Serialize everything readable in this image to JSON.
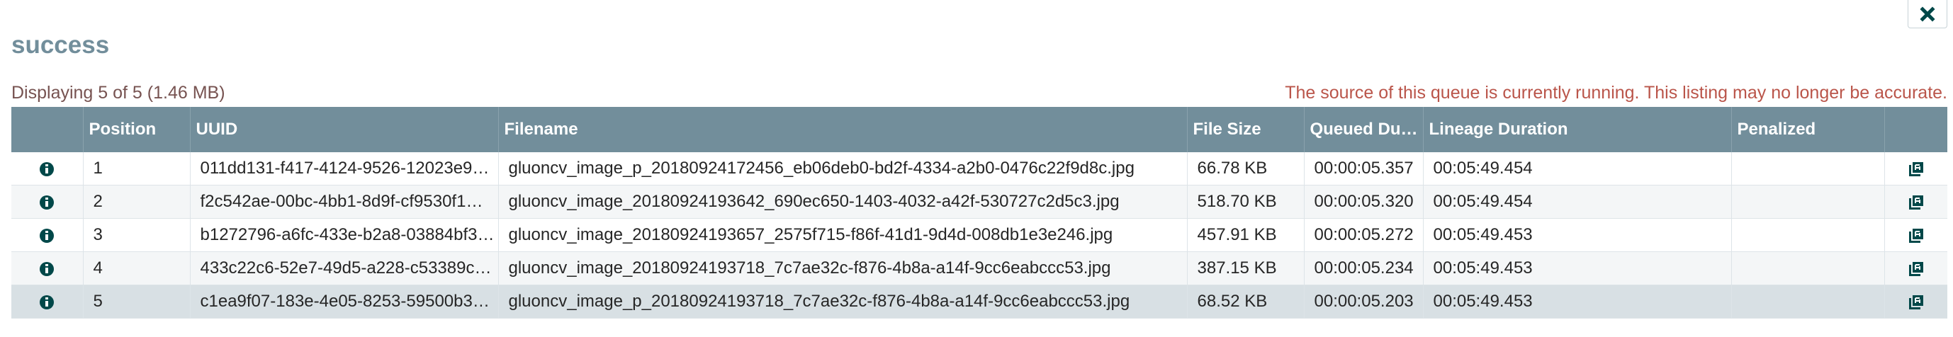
{
  "header": {
    "title": "success",
    "close_icon": "close-icon"
  },
  "summary": {
    "count_text": "Displaying 5 of 5 (1.46 MB)",
    "warning_text": "The source of this queue is currently running. This listing may no longer be accurate."
  },
  "colors": {
    "header_bg": "#728e9b",
    "title": "#728e9b",
    "count_text": "#775351",
    "warning": "#ba554a",
    "icon": "#004849",
    "selected_row": "#d8e0e4"
  },
  "table": {
    "columns": [
      "",
      "Position",
      "UUID",
      "Filename",
      "File Size",
      "Queued Dur…",
      "Lineage Duration",
      "Penalized",
      ""
    ],
    "rows": [
      {
        "position": "1",
        "uuid": "011dd131-f417-4124-9526-12023e9…",
        "filename": "gluoncv_image_p_20180924172456_eb06deb0-bd2f-4334-a2b0-0476c22f9d8c.jpg",
        "file_size": "66.78 KB",
        "queued_duration": "00:00:05.357",
        "lineage_duration": "00:05:49.454",
        "penalized": ""
      },
      {
        "position": "2",
        "uuid": "f2c542ae-00bc-4bb1-8d9f-cf9530f1…",
        "filename": "gluoncv_image_20180924193642_690ec650-1403-4032-a42f-530727c2d5c3.jpg",
        "file_size": "518.70 KB",
        "queued_duration": "00:00:05.320",
        "lineage_duration": "00:05:49.454",
        "penalized": ""
      },
      {
        "position": "3",
        "uuid": "b1272796-a6fc-433e-b2a8-03884bf3…",
        "filename": "gluoncv_image_20180924193657_2575f715-f86f-41d1-9d4d-008db1e3e246.jpg",
        "file_size": "457.91 KB",
        "queued_duration": "00:00:05.272",
        "lineage_duration": "00:05:49.453",
        "penalized": ""
      },
      {
        "position": "4",
        "uuid": "433c22c6-52e7-49d5-a228-c53389c…",
        "filename": "gluoncv_image_20180924193718_7c7ae32c-f876-4b8a-a14f-9cc6eabccc53.jpg",
        "file_size": "387.15 KB",
        "queued_duration": "00:00:05.234",
        "lineage_duration": "00:05:49.453",
        "penalized": ""
      },
      {
        "position": "5",
        "uuid": "c1ea9f07-183e-4e05-8253-59500b3…",
        "filename": "gluoncv_image_p_20180924193718_7c7ae32c-f876-4b8a-a14f-9cc6eabccc53.jpg",
        "file_size": "68.52 KB",
        "queued_duration": "00:00:05.203",
        "lineage_duration": "00:05:49.453",
        "penalized": ""
      }
    ],
    "row_icons": {
      "details": "info-icon",
      "provenance": "provenance-icon"
    }
  }
}
